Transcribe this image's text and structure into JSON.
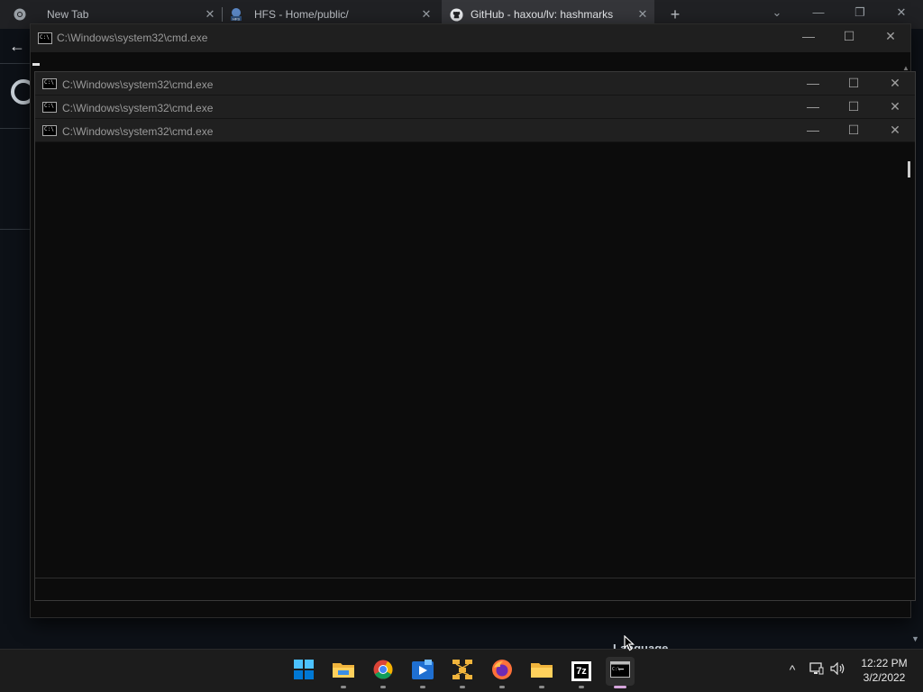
{
  "browser": {
    "tabs": [
      {
        "title": "New Tab",
        "icon": "chrome-icon"
      },
      {
        "title": "HFS - Home/public/",
        "icon": "hfs-icon"
      },
      {
        "title": "GitHub - haxou/lv: hashmarks",
        "icon": "github-icon"
      }
    ],
    "new_tab_symbol": "+",
    "controls": {
      "minimize": "—",
      "restore": "❐",
      "close": "✕",
      "tablist": "⌄"
    },
    "back_symbol": "←",
    "partial_text": "Language"
  },
  "cmd_main": {
    "title": "C:\\Windows\\system32\\cmd.exe",
    "controls": {
      "minimize": "—",
      "maximize": "☐",
      "close": "✕"
    }
  },
  "cmd_stack": [
    {
      "title": "C:\\Windows\\system32\\cmd.exe"
    },
    {
      "title": "C:\\Windows\\system32\\cmd.exe"
    },
    {
      "title": "C:\\Windows\\system32\\cmd.exe"
    }
  ],
  "cmd_controls": {
    "minimize": "—",
    "maximize": "☐",
    "close": "✕"
  },
  "taskbar": {
    "apps": [
      {
        "name": "start",
        "icon": "windows-start-icon"
      },
      {
        "name": "file-explorer",
        "icon": "folder-icon"
      },
      {
        "name": "chrome",
        "icon": "chrome-icon"
      },
      {
        "name": "media-player",
        "icon": "media-player-icon"
      },
      {
        "name": "network-tool",
        "icon": "network-icon"
      },
      {
        "name": "firefox",
        "icon": "firefox-icon"
      },
      {
        "name": "file-explorer-2",
        "icon": "folder-icon"
      },
      {
        "name": "7zip",
        "icon": "7zip-icon",
        "label": "7z"
      },
      {
        "name": "command-prompt",
        "icon": "cmd-icon",
        "active": true
      }
    ],
    "tray": {
      "chevron": "^"
    },
    "clock": {
      "time": "12:22 PM",
      "date": "3/2/2022"
    }
  },
  "colors": {
    "accent_indicator": "#d6a5dc",
    "terminal_bg": "#0c0c0c",
    "taskbar_bg": "#1c1c1c"
  }
}
